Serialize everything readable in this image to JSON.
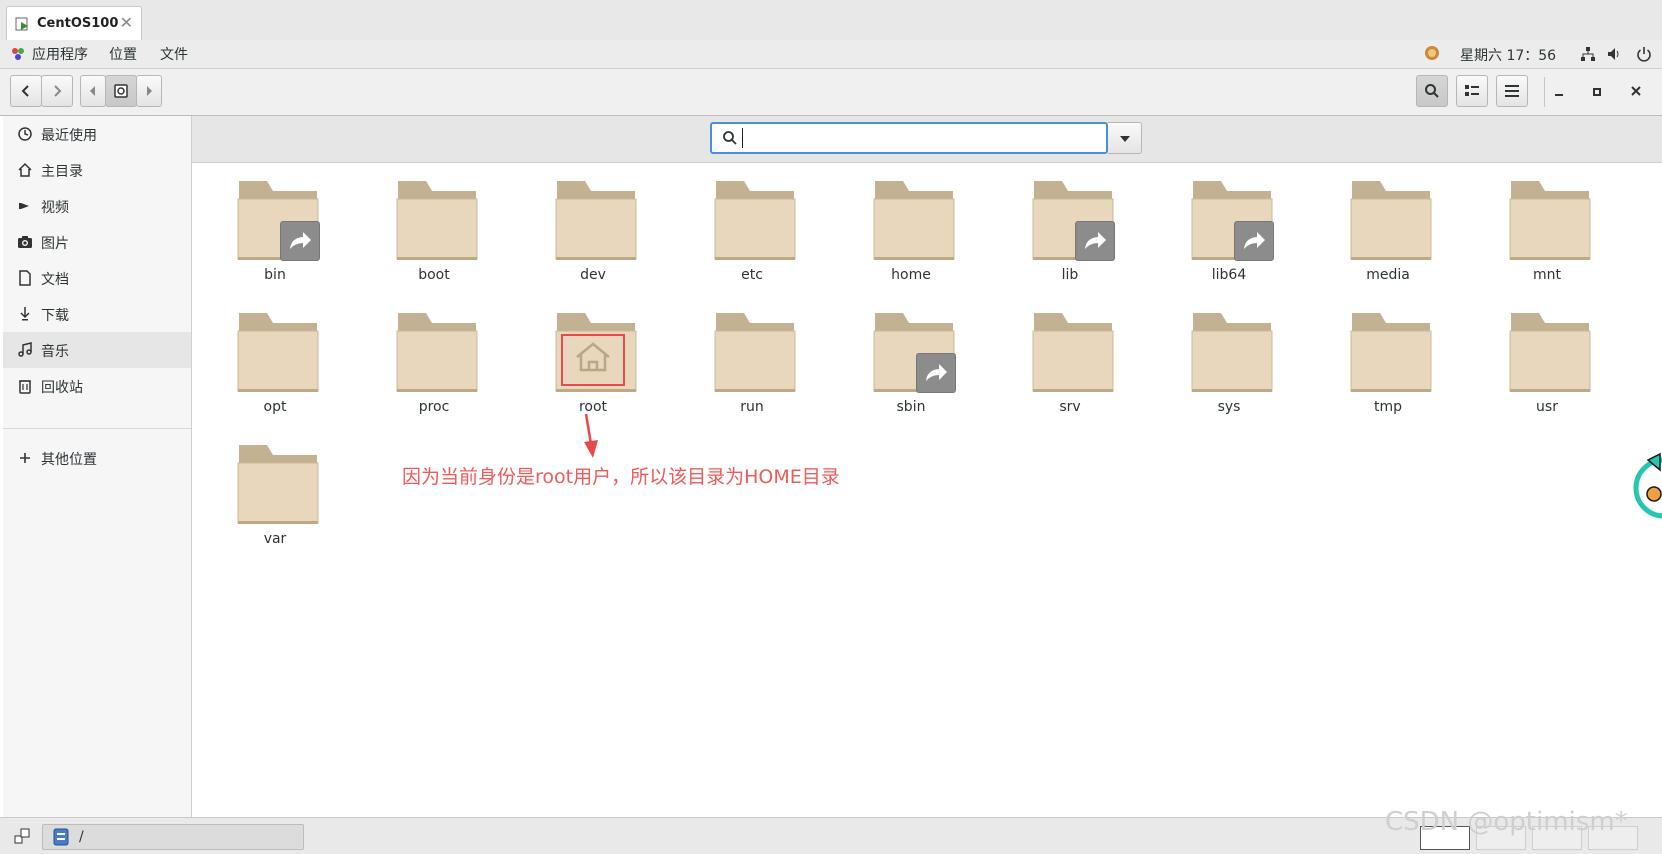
{
  "vm_tab": {
    "title": "CentOS100",
    "close": "✕"
  },
  "top_panel": {
    "menu": [
      "应用程序",
      "位置",
      "文件"
    ],
    "clock": "星期六 17：56"
  },
  "sidebar": {
    "items": [
      {
        "label": "最近使用",
        "icon": "clock-icon"
      },
      {
        "label": "主目录",
        "icon": "home-icon"
      },
      {
        "label": "视频",
        "icon": "video-icon"
      },
      {
        "label": "图片",
        "icon": "camera-icon"
      },
      {
        "label": "文档",
        "icon": "document-icon"
      },
      {
        "label": "下载",
        "icon": "download-icon"
      },
      {
        "label": "音乐",
        "icon": "music-icon"
      },
      {
        "label": "回收站",
        "icon": "trash-icon"
      }
    ],
    "other_locations": "其他位置",
    "selected_index": 6
  },
  "search": {
    "value": "",
    "placeholder": ""
  },
  "files": [
    {
      "name": "bin",
      "link": true
    },
    {
      "name": "boot",
      "link": false
    },
    {
      "name": "dev",
      "link": false
    },
    {
      "name": "etc",
      "link": false
    },
    {
      "name": "home",
      "link": false
    },
    {
      "name": "lib",
      "link": true
    },
    {
      "name": "lib64",
      "link": true
    },
    {
      "name": "media",
      "link": false
    },
    {
      "name": "mnt",
      "link": false
    },
    {
      "name": "opt",
      "link": false
    },
    {
      "name": "proc",
      "link": false
    },
    {
      "name": "root",
      "link": false,
      "home": true
    },
    {
      "name": "run",
      "link": false
    },
    {
      "name": "sbin",
      "link": true
    },
    {
      "name": "srv",
      "link": false
    },
    {
      "name": "sys",
      "link": false
    },
    {
      "name": "tmp",
      "link": false
    },
    {
      "name": "usr",
      "link": false
    },
    {
      "name": "var",
      "link": false
    }
  ],
  "annotation": "因为当前身份是root用户，所以该目录为HOME目录",
  "path": "/",
  "watermark": "CSDN @optimism*",
  "colors": {
    "folder_body": "#e8d7bd",
    "folder_tab": "#c2b193",
    "annotation": "#f05a5a",
    "search_focus": "#4a90d9"
  }
}
